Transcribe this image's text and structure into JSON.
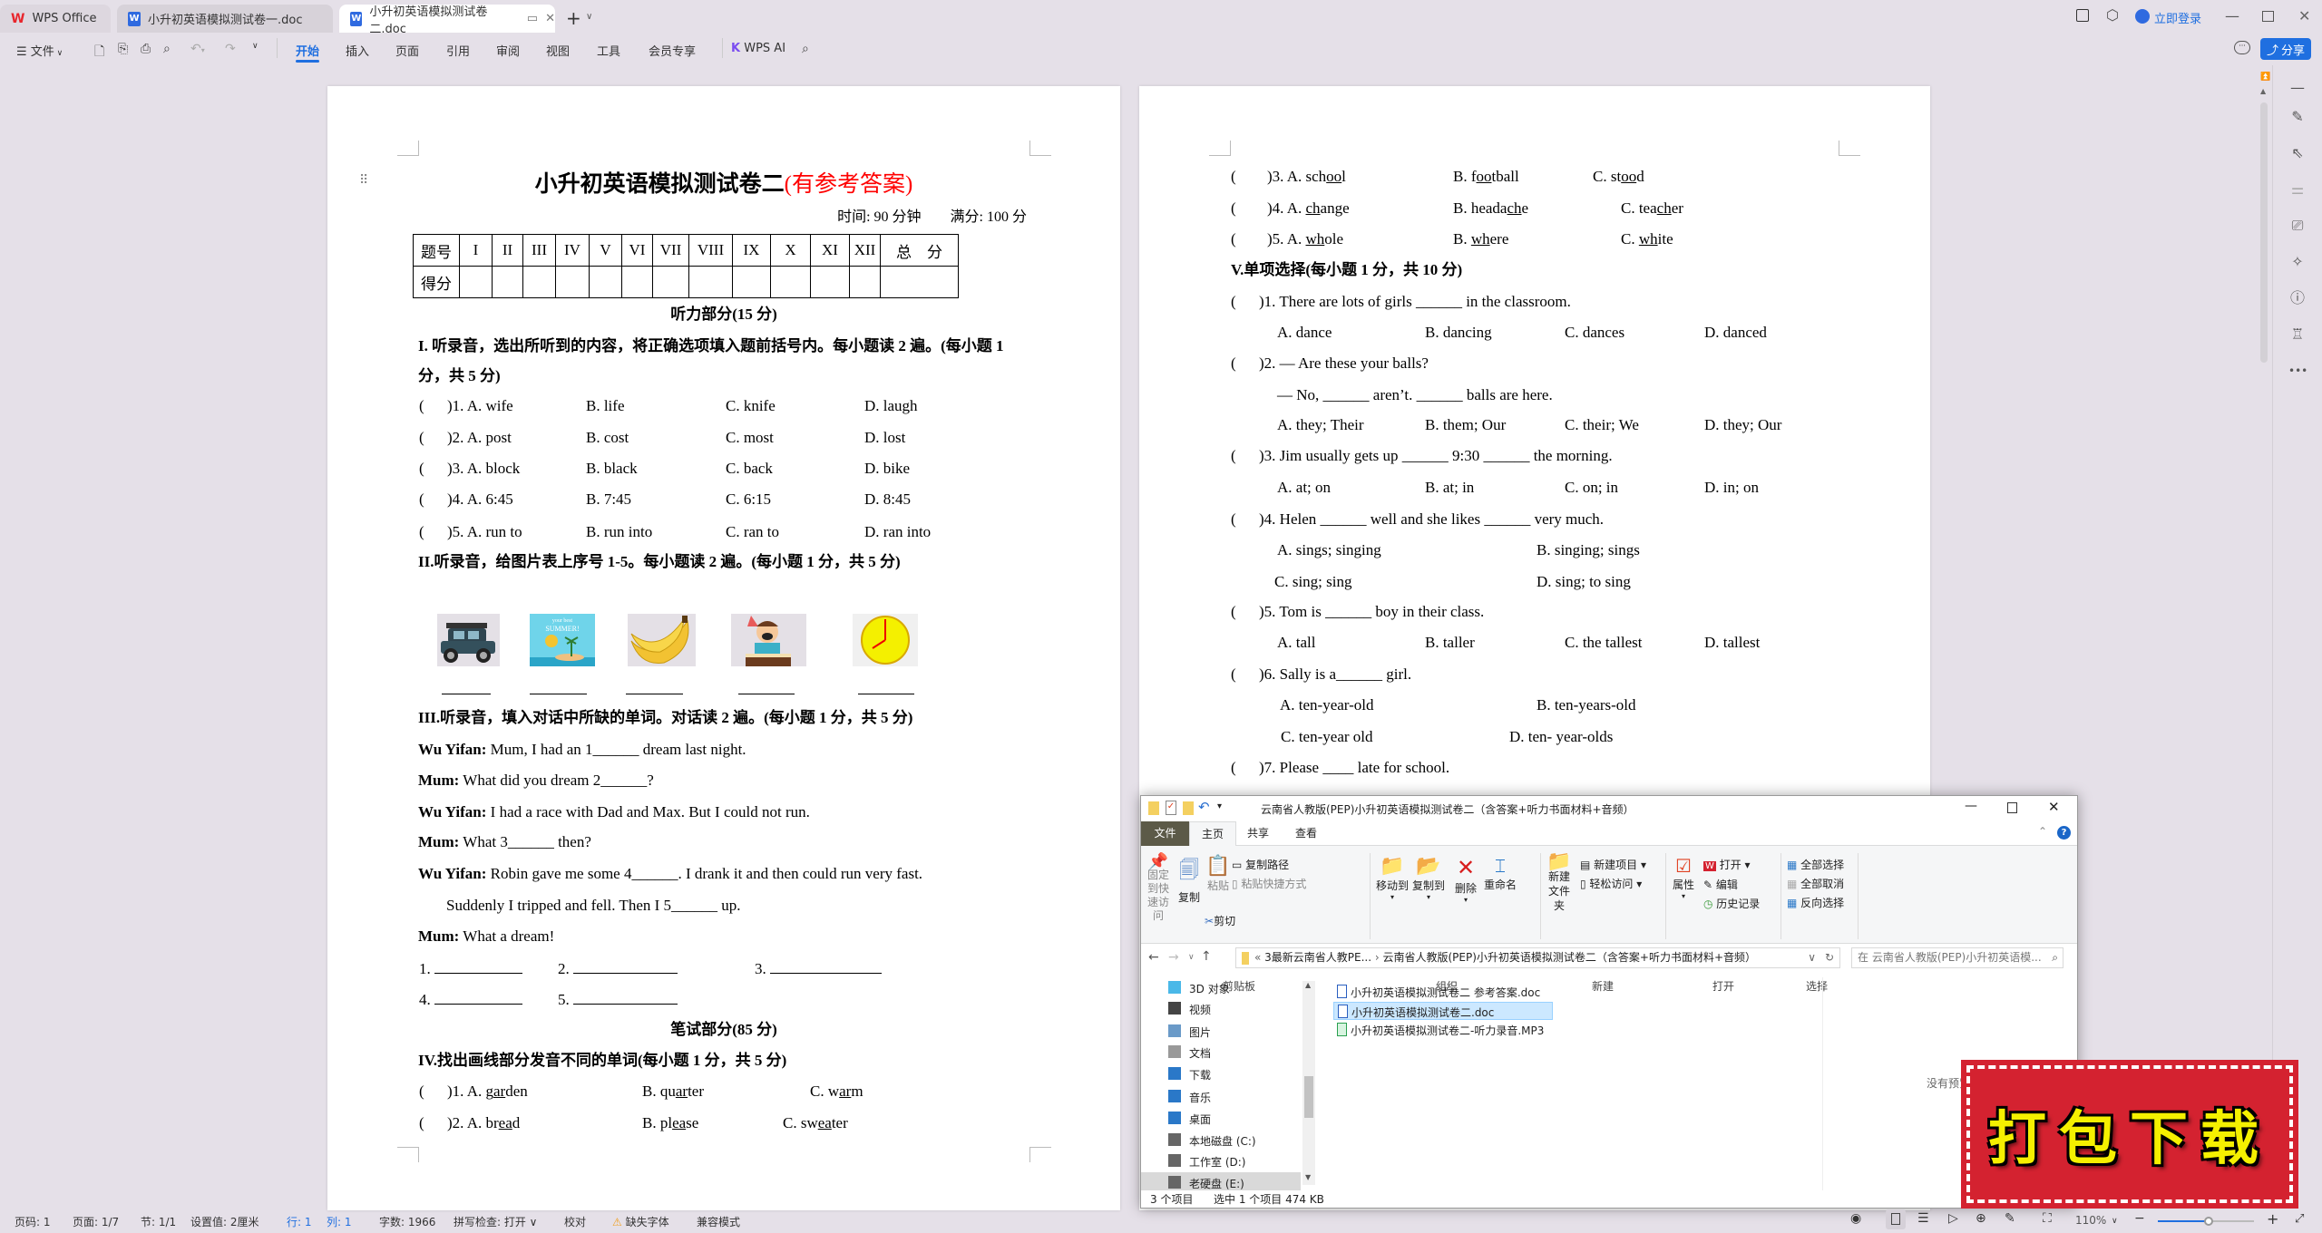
{
  "app": {
    "tabs": [
      {
        "label": "WPS Office",
        "icon": "wps-logo-icon"
      },
      {
        "label": "小升初英语模拟测试卷一.doc",
        "icon": "word-doc-icon"
      },
      {
        "label": "小升初英语模拟测试卷二.doc",
        "icon": "word-doc-icon",
        "active": true
      }
    ],
    "login": "立即登录",
    "share": "分享",
    "brand_color": "#2f6ae0",
    "accent_color": "#1f6fe0"
  },
  "toolbar": {
    "file_menu": "文件",
    "ribbon_tabs": [
      "开始",
      "插入",
      "页面",
      "引用",
      "审阅",
      "视图",
      "工具",
      "会员专享"
    ],
    "active_tab": "开始",
    "wps_ai": "WPS AI"
  },
  "left_page": {
    "title": "小升初英语模拟测试卷二",
    "title_note": "(有参考答案)",
    "title_note_color": "#ff0000",
    "time": "时间: 90 分钟",
    "full_score": "满分: 100 分",
    "score_table": {
      "header": [
        "题号",
        "I",
        "II",
        "III",
        "IV",
        "V",
        "VI",
        "VII",
        "VIII",
        "IX",
        "X",
        "XI",
        "XII",
        "总　分"
      ],
      "row_label": "得分"
    },
    "listening_heading": "听力部分(15 分)",
    "section1": {
      "instruction_1": "I. 听录音，选出所听到的内容，将正确选项填入题前括号内。每小题读 2 遍。(每小题 1",
      "instruction_2": "分，共 5 分)",
      "rows": [
        [
          "(",
          ")1. A. wife",
          "B. life",
          "C. knife",
          "D. laugh"
        ],
        [
          "(",
          ")2. A. post",
          "B. cost",
          "C. most",
          "D. lost"
        ],
        [
          "(",
          ")3. A. block",
          "B. black",
          "C. back",
          "D. bike"
        ],
        [
          "(",
          ")4. A. 6:45",
          "B. 7:45",
          "C. 6:15",
          "D. 8:45"
        ],
        [
          "(",
          ")5. A. run to",
          "B. run into",
          "C. ran to",
          "D. ran into"
        ]
      ]
    },
    "section2": {
      "instruction": "II.听录音，给图片表上序号 1-5。每小题读 2 遍。(每小题 1 分，共 5 分)",
      "pictures": [
        "jeep",
        "summer-poster",
        "bananas",
        "birthday-boy",
        "clock"
      ],
      "poster_text": [
        "your best",
        "SUMMER!"
      ]
    },
    "section3": {
      "instruction": "III.听录音，填入对话中所缺的单词。对话读 2 遍。(每小题 1 分，共 5 分)",
      "dialog": [
        {
          "speaker": "Wu Yifan:",
          "text": " Mum, I had an 1______ dream last night."
        },
        {
          "speaker": "Mum:",
          "text": " What did you dream 2______?"
        },
        {
          "speaker": "Wu Yifan:",
          "text": " I had a race with Dad and Max. But I could not run."
        },
        {
          "speaker": "Mum:",
          "text": " What 3______ then?"
        },
        {
          "speaker": "Wu Yifan:",
          "text": " Robin gave me some 4______. I drank it and then could run very fast."
        },
        {
          "speaker": "",
          "text": "Suddenly I tripped and fell. Then I 5______ up."
        },
        {
          "speaker": "Mum:",
          "text": " What a dream!"
        }
      ],
      "answers": [
        "1.",
        "2.",
        "3.",
        "4.",
        "5."
      ]
    },
    "written_heading": "笔试部分(85 分)",
    "section4": {
      "instruction": "IV.找出画线部分发音不同的单词(每小题 1 分，共 5 分)",
      "rows": [
        [
          "(",
          {
            "t": ")1. A. garden",
            "u": "ar"
          },
          {
            "t": "B. quarter",
            "u": "ar"
          },
          {
            "t": "C. warm",
            "u": "ar"
          }
        ],
        [
          "(",
          {
            "t": ")2. A. bread",
            "u": "ea"
          },
          {
            "t": "B. please",
            "u": "ea"
          },
          {
            "t": "C. sweater",
            "u": "ea"
          }
        ]
      ]
    }
  },
  "right_page": {
    "lines": [
      [
        "(",
        {
          "t": ")3. A. school",
          "u": "oo"
        },
        {
          "t": "B. football",
          "u": "oo"
        },
        {
          "t": "C. stood",
          "u": "oo"
        }
      ],
      [
        "(",
        {
          "t": ")4. A. change",
          "u": "ch"
        },
        {
          "t": "B. headache",
          "u": "ch"
        },
        {
          "t": "C. teacher",
          "u": "ch"
        }
      ],
      [
        "(",
        {
          "t": ")5. A. whole",
          "u": "wh"
        },
        {
          "t": "B. where",
          "u": "wh"
        },
        {
          "t": "C. white",
          "u": "wh"
        }
      ],
      [
        {
          "t": "V.单项选择(每小题 1 分，共 10 分)",
          "bold": true
        }
      ],
      [
        "(",
        ")1. There are lots of girls ______ in the classroom."
      ],
      [
        "A.  dance",
        "B. dancing",
        "C. dances",
        "D. danced"
      ],
      [
        "(",
        ")2. — Are these your balls?"
      ],
      [
        "— No, ______ aren’t. ______ balls are here."
      ],
      [
        "A.  they;  Their",
        "B. them;  Our",
        "C. their;  We",
        "D. they;  Our"
      ],
      [
        "(",
        ")3. Jim usually gets up ______ 9:30 ______ the morning."
      ],
      [
        "A.  at; on",
        "B. at; in",
        "C. on; in",
        "D. in; on"
      ],
      [
        "(",
        ")4. Helen ______ well and she likes ______ very much."
      ],
      [
        "A.  sings; singing",
        "B. singing; sings"
      ],
      [
        "C. sing; sing",
        "D. sing; to sing"
      ],
      [
        "(",
        ")5. Tom is ______ boy in their class."
      ],
      [
        "A.  tall",
        "B. taller",
        "C. the tallest",
        "D. tallest"
      ],
      [
        "(",
        ")6. Sally is a______ girl."
      ],
      [
        "A.  ten-year-old",
        "B.  ten-years-old"
      ],
      [
        "C.  ten-year  old",
        "D. ten- year-olds"
      ],
      [
        "(",
        ")7. Please ____ late for school."
      ]
    ]
  },
  "explorer": {
    "title": "云南省人教版(PEP)小升初英语模拟测试卷二（含答案+听力书面材料+音频）",
    "tabs": [
      "文件",
      "主页",
      "共享",
      "查看"
    ],
    "active_tab": "主页",
    "groups": [
      {
        "label": "剪贴板",
        "buttons": [
          "固定到快速访问",
          "复制",
          "粘贴",
          "复制路径",
          "粘贴快捷方式",
          "剪切"
        ]
      },
      {
        "label": "组织",
        "buttons": [
          "移动到",
          "复制到",
          "删除",
          "重命名"
        ]
      },
      {
        "label": "新建",
        "buttons": [
          "新建文件夹",
          "新建项目",
          "轻松访问"
        ]
      },
      {
        "label": "打开",
        "buttons": [
          "属性",
          "打开",
          "编辑",
          "历史记录"
        ]
      },
      {
        "label": "选择",
        "buttons": [
          "全部选择",
          "全部取消",
          "反向选择"
        ]
      }
    ],
    "breadcrumb": [
      "3最新云南省人教PE...",
      "云南省人教版(PEP)小升初英语模拟测试卷二（含答案+听力书面材料+音频）"
    ],
    "search_placeholder": "在 云南省人教版(PEP)小升初英语模...",
    "nav_items": [
      {
        "label": "3D 对象",
        "icon": "3d-objects-icon"
      },
      {
        "label": "视频",
        "icon": "video-icon"
      },
      {
        "label": "图片",
        "icon": "pictures-icon"
      },
      {
        "label": "文档",
        "icon": "documents-icon"
      },
      {
        "label": "下载",
        "icon": "download-icon"
      },
      {
        "label": "音乐",
        "icon": "music-icon"
      },
      {
        "label": "桌面",
        "icon": "desktop-icon"
      },
      {
        "label": "本地磁盘 (C:)",
        "icon": "drive-icon"
      },
      {
        "label": "工作室 (D:)",
        "icon": "drive-icon"
      },
      {
        "label": "老硬盘 (E:)",
        "icon": "drive-icon",
        "selected": true
      }
    ],
    "files": [
      {
        "name": "小升初英语模拟测试卷二 参考答案.doc",
        "icon": "word-file-icon"
      },
      {
        "name": "小升初英语模拟测试卷二.doc",
        "icon": "word-file-icon",
        "selected": true
      },
      {
        "name": "小升初英语模拟测试卷二-听力录音.MP3",
        "icon": "audio-file-icon"
      }
    ],
    "preview_text": "没有预览。",
    "status_count": "3 个项目",
    "status_selection": "选中 1 个项目  474 KB"
  },
  "statusbar": {
    "items": [
      "页码: 1",
      "页面: 1/7",
      "节: 1/1",
      "设置值: 2厘米",
      "行: 1",
      "列: 1",
      "字数: 1966",
      "拼写检查: 打开",
      "校对",
      "缺失字体",
      "兼容模式"
    ],
    "zoom": "110%",
    "zoom_percent": 110
  },
  "watermark": {
    "text": "打包下载"
  }
}
